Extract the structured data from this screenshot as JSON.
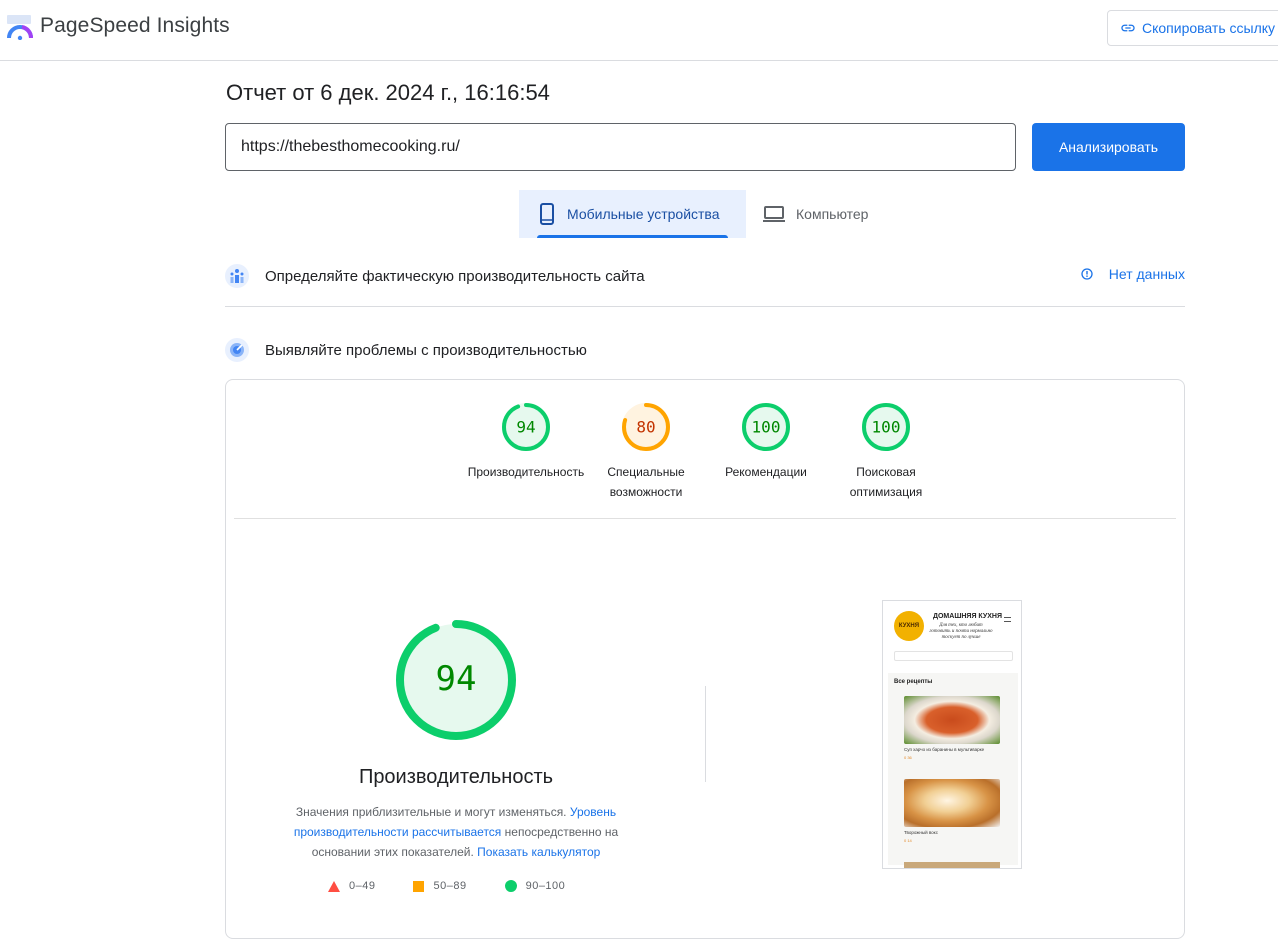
{
  "header": {
    "app_title": "PageSpeed Insights",
    "copy_link_label": "Скопировать ссылку"
  },
  "report": {
    "date_text": "Отчет от 6 дек. 2024 г., 16:16:54"
  },
  "url_form": {
    "url_value": "https://thebesthomecooking.ru/",
    "analyze_label": "Анализировать"
  },
  "tabs": [
    {
      "label": "Мобильные устройства",
      "selected": true,
      "icon": "smartphone-icon"
    },
    {
      "label": "Компьютер",
      "selected": false,
      "icon": "laptop-icon"
    }
  ],
  "field_data": {
    "title": "Определяйте фактическую производительность сайта",
    "status": "Нет данных"
  },
  "lab_data": {
    "title": "Выявляйте проблемы с производительностью"
  },
  "gauges": [
    {
      "score": "94",
      "label": "Производительность",
      "color": "#0cce6b",
      "fill": 0.94
    },
    {
      "score": "80",
      "label": "Специальные возможности",
      "color": "#ffa400",
      "fill": 0.8
    },
    {
      "score": "100",
      "label": "Рекомендации",
      "color": "#0cce6b",
      "fill": 1.0
    },
    {
      "score": "100",
      "label": "Поисковая оптимизация",
      "color": "#0cce6b",
      "fill": 1.0
    }
  ],
  "performance": {
    "score": "94",
    "fill": 0.94,
    "title": "Производительность",
    "desc_part1": "Значения приблизительные и могут изменяться.",
    "desc_link1": "Уровень производительности рассчитывается",
    "desc_part2": "непосредственно на основании этих показателей.",
    "desc_link2": "Показать калькулятор"
  },
  "legend": [
    {
      "range": "0–49",
      "shape": "triangle",
      "color": "#ff4e42"
    },
    {
      "range": "50–89",
      "shape": "square",
      "color": "#ffa400"
    },
    {
      "range": "90–100",
      "shape": "circle",
      "color": "#0cce6b"
    }
  ],
  "preview": {
    "logo_text": "КУХНЯ",
    "site_title": "ДОМАШНЯЯ КУХНЯ",
    "site_subtitle": "Для тех, кто любит готовить и почти нормально тоскует по лучше",
    "all_recipes": "Все рецепты",
    "recipe1": "Суп харчо из баранины в мультиварке",
    "recipe1_meta": "0   36",
    "recipe2": "Творожный вокс",
    "recipe2_meta": "0   14"
  },
  "colors": {
    "accent": "#1a73e8",
    "pass": "#0cce6b",
    "average": "#ffa400",
    "fail": "#ff4e42"
  }
}
